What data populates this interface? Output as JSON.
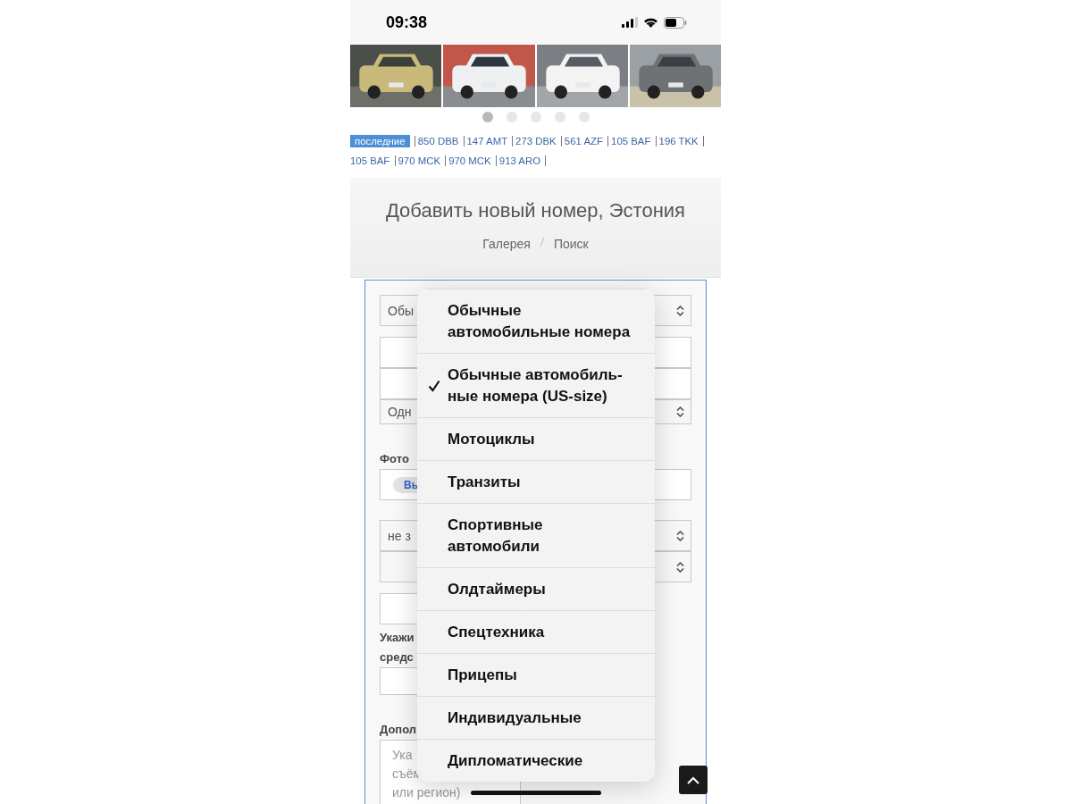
{
  "status_bar": {
    "time": "09:38"
  },
  "carousel": {
    "dots": [
      {
        "selected": true
      },
      {
        "selected": false
      },
      {
        "selected": false
      },
      {
        "selected": false
      },
      {
        "selected": false
      }
    ]
  },
  "recent_plates": {
    "badge": "последние",
    "plates": [
      "850 DBB",
      "147 AMT",
      "273 DBK",
      "561 AZF",
      "105 BAF",
      "196 TKK",
      "105 BAF",
      "970 MCK",
      "970 MCK",
      "913 ARO"
    ]
  },
  "header": {
    "title": "Добавить новый номер, Эстония",
    "breadcrumbs": [
      "Галерея",
      "Поиск"
    ]
  },
  "form": {
    "fields": [
      {
        "kind": "select",
        "value": "Обы"
      },
      {
        "kind": "input"
      },
      {
        "kind": "input"
      },
      {
        "kind": "select",
        "value": "Одн"
      },
      {
        "kind": "label",
        "lines": [
          "Фото"
        ]
      },
      {
        "kind": "file",
        "button": "Вы"
      },
      {
        "kind": "select",
        "value": "не з"
      },
      {
        "kind": "select"
      },
      {
        "kind": "input"
      },
      {
        "kind": "label",
        "lines": [
          "Укажи",
          "средс"
        ]
      },
      {
        "kind": "input"
      },
      {
        "kind": "label",
        "lines": [
          "Допол"
        ]
      },
      {
        "kind": "textarea",
        "placeholder": [
          "Ука",
          "съём",
          "или регион)"
        ]
      }
    ]
  },
  "dropdown_menu": {
    "items": [
      {
        "lines": [
          "Обычные",
          "автомобильные номера"
        ],
        "selected": false
      },
      {
        "lines": [
          "Обычные автомобиль-",
          "ные номера (US-size)"
        ],
        "selected": true
      },
      {
        "lines": [
          "Мотоциклы"
        ],
        "selected": false
      },
      {
        "lines": [
          "Транзиты"
        ],
        "selected": false
      },
      {
        "lines": [
          "Спортивные",
          "автомобили"
        ],
        "selected": false
      },
      {
        "lines": [
          "Олдтаймеры"
        ],
        "selected": false
      },
      {
        "lines": [
          "Спецтехника"
        ],
        "selected": false
      },
      {
        "lines": [
          "Прицепы"
        ],
        "selected": false
      },
      {
        "lines": [
          "Индивидуальные"
        ],
        "selected": false
      },
      {
        "lines": [
          "Дипломатические"
        ],
        "selected": false
      }
    ]
  }
}
